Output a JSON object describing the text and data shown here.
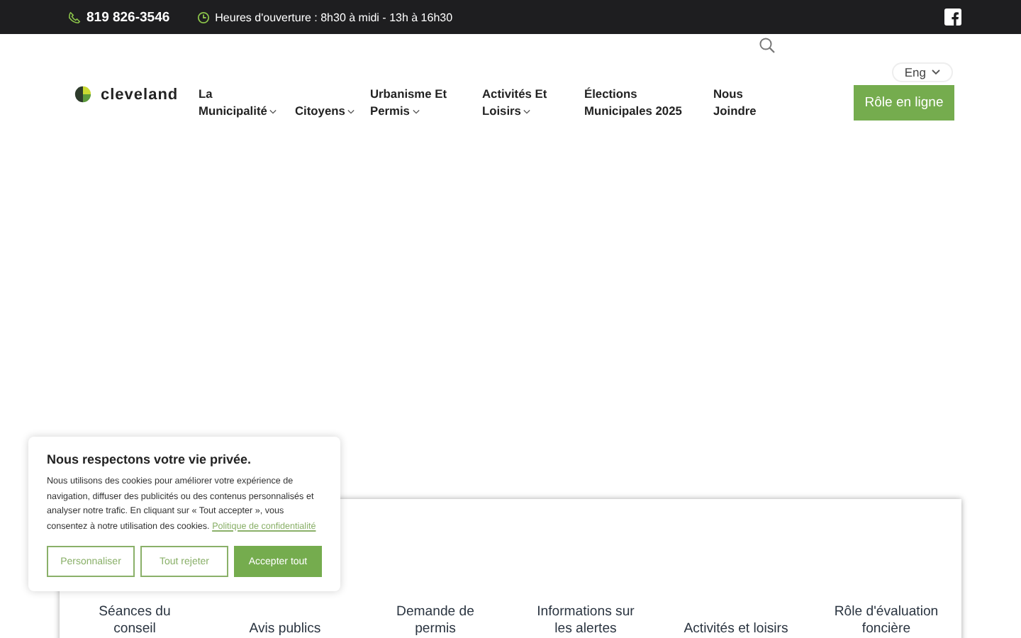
{
  "top_bar": {
    "phone": "819 826-3546",
    "hours": "Heures d'ouverture : 8h30 à midi - 13h à 16h30"
  },
  "header": {
    "logo_text": "cleveland",
    "language": "Eng",
    "cta": "Rôle en ligne",
    "nav": [
      {
        "label": "La Municipalité",
        "dropdown": true
      },
      {
        "label": "Citoyens",
        "dropdown": true
      },
      {
        "label": "Urbanisme Et Permis",
        "dropdown": true
      },
      {
        "label": "Activités Et Loisirs",
        "dropdown": true
      },
      {
        "label": "Élections Municipales 2025",
        "dropdown": false
      },
      {
        "label": "Nous Joindre",
        "dropdown": false
      }
    ]
  },
  "quick_links": [
    "Séances du conseil",
    "Avis publics",
    "Demande de permis",
    "Informations sur les alertes",
    "Activités et loisirs",
    "Rôle d'évaluation foncière"
  ],
  "cookie_banner": {
    "title": "Nous respectons votre vie privée.",
    "text": "Nous utilisons des cookies pour améliorer votre expérience de navigation, diffuser des publicités ou des contenus personnalisés et analyser notre trafic. En cliquant sur « Tout accepter », vous consentez à notre utilisation des cookies.",
    "link": "Politique de confidentialité",
    "buttons": [
      {
        "label": "Personnaliser",
        "kind": "outline"
      },
      {
        "label": "Tout rejeter",
        "kind": "outline"
      },
      {
        "label": "Accepter tout",
        "kind": "primary"
      }
    ]
  }
}
